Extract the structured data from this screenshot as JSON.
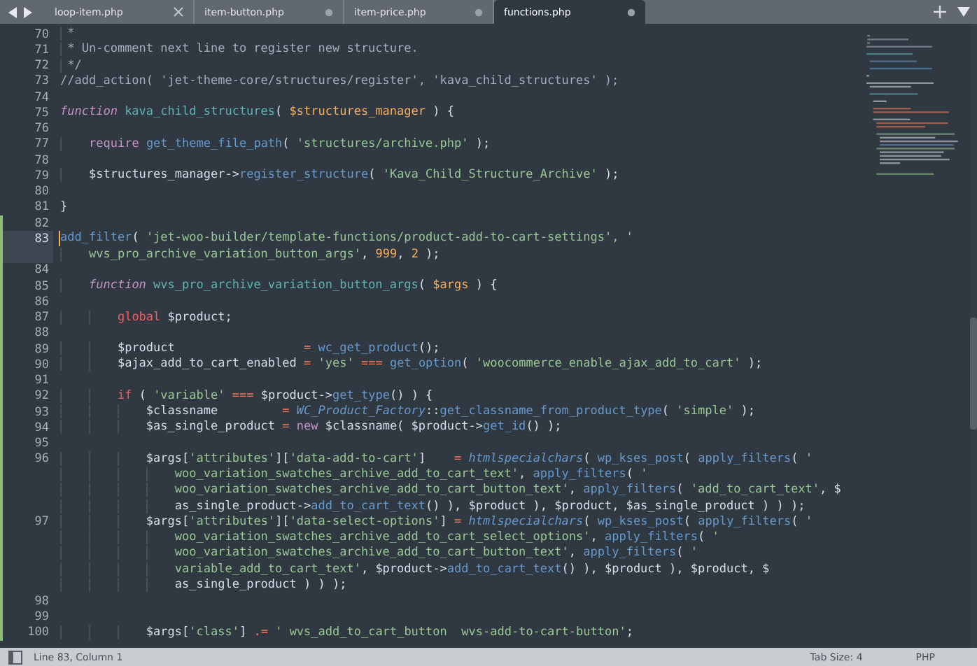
{
  "tabs": [
    {
      "label": "loop-item.php",
      "selected": false,
      "modified": false
    },
    {
      "label": "item-button.php",
      "selected": false,
      "modified": true
    },
    {
      "label": "item-price.php",
      "selected": false,
      "modified": true
    },
    {
      "label": "functions.php",
      "selected": true,
      "modified": true
    }
  ],
  "rows": [
    {
      "num": "70",
      "changed": false,
      "current": false,
      "tokens": [
        {
          "t": " *",
          "kind": "comment"
        }
      ]
    },
    {
      "num": "71",
      "changed": false,
      "current": false,
      "tokens": [
        {
          "t": " * Un-comment next line to register new structure.",
          "kind": "comment"
        }
      ]
    },
    {
      "num": "72",
      "changed": false,
      "current": false,
      "tokens": [
        {
          "t": " */",
          "kind": "comment"
        }
      ]
    },
    {
      "num": "73",
      "changed": false,
      "current": false,
      "tokens": [
        {
          "t": "//add_action( 'jet-theme-core/structures/register', 'kava_child_structures' );",
          "kind": "comment"
        }
      ]
    },
    {
      "num": "74",
      "changed": false,
      "current": false
    },
    {
      "num": "75",
      "changed": false,
      "current": false,
      "tokens": [
        {
          "t": "function ",
          "kind": "keyword"
        },
        {
          "t": "kava_child_structures",
          "kind": "defname"
        },
        {
          "t": "( ",
          "kind": "plain"
        },
        {
          "t": "$structures_manager",
          "kind": "param"
        },
        {
          "t": " ) {",
          "kind": "plain"
        }
      ]
    },
    {
      "num": "76",
      "changed": false,
      "current": false
    },
    {
      "num": "77",
      "changed": false,
      "current": false,
      "tokens": [
        {
          "t": "    require ",
          "kind": "storage"
        },
        {
          "t": "get_theme_file_path",
          "kind": "call"
        },
        {
          "t": "( ",
          "kind": "plain"
        },
        {
          "t": "'structures/archive.php'",
          "kind": "string"
        },
        {
          "t": " );",
          "kind": "plain"
        }
      ]
    },
    {
      "num": "78",
      "changed": false,
      "current": false
    },
    {
      "num": "79",
      "changed": false,
      "current": false,
      "tokens": [
        {
          "t": "    $structures_manager->",
          "kind": "plain"
        },
        {
          "t": "register_structure",
          "kind": "call"
        },
        {
          "t": "( ",
          "kind": "plain"
        },
        {
          "t": "'Kava_Child_Structure_Archive'",
          "kind": "string"
        },
        {
          "t": " );",
          "kind": "plain"
        }
      ]
    },
    {
      "num": "80",
      "changed": false,
      "current": false
    },
    {
      "num": "81",
      "changed": false,
      "current": false,
      "tokens": [
        {
          "t": "}",
          "kind": "plain"
        }
      ]
    },
    {
      "num": "82",
      "changed": true,
      "current": false
    },
    {
      "num": "83",
      "changed": true,
      "current": true,
      "tokens": [
        {
          "t": "add_filter",
          "kind": "call"
        },
        {
          "t": "( ",
          "kind": "plain"
        },
        {
          "t": "'jet-woo-builder/template-functions/product-add-to-cart-settings', '",
          "kind": "string"
        }
      ]
    },
    {
      "changed": true,
      "current": true,
      "tokens": [
        {
          "t": "    wvs_pro_archive_variation_button_args'",
          "kind": "string"
        },
        {
          "t": ", ",
          "kind": "plain"
        },
        {
          "t": "999",
          "kind": "number"
        },
        {
          "t": ", ",
          "kind": "plain"
        },
        {
          "t": "2",
          "kind": "number"
        },
        {
          "t": " );",
          "kind": "plain"
        }
      ]
    },
    {
      "num": "84",
      "changed": true,
      "current": false
    },
    {
      "num": "85",
      "changed": true,
      "current": false,
      "tokens": [
        {
          "t": "    function ",
          "kind": "keyword"
        },
        {
          "t": "wvs_pro_archive_variation_button_args",
          "kind": "defname"
        },
        {
          "t": "( ",
          "kind": "plain"
        },
        {
          "t": "$args",
          "kind": "param"
        },
        {
          "t": " ) {",
          "kind": "plain"
        }
      ]
    },
    {
      "num": "86",
      "changed": true,
      "current": false
    },
    {
      "num": "87",
      "changed": true,
      "current": false,
      "tokens": [
        {
          "t": "        global",
          "kind": "control"
        },
        {
          "t": " $product;",
          "kind": "plain"
        }
      ]
    },
    {
      "num": "88",
      "changed": true,
      "current": false
    },
    {
      "num": "89",
      "changed": true,
      "current": false,
      "tokens": [
        {
          "t": "        $product                  ",
          "kind": "plain"
        },
        {
          "t": "= ",
          "kind": "operator"
        },
        {
          "t": "wc_get_product",
          "kind": "call"
        },
        {
          "t": "();",
          "kind": "plain"
        }
      ]
    },
    {
      "num": "90",
      "changed": true,
      "current": false,
      "tokens": [
        {
          "t": "        $ajax_add_to_cart_enabled ",
          "kind": "plain"
        },
        {
          "t": "= ",
          "kind": "operator"
        },
        {
          "t": "'yes' ",
          "kind": "string"
        },
        {
          "t": "=== ",
          "kind": "operator"
        },
        {
          "t": "get_option",
          "kind": "call"
        },
        {
          "t": "( ",
          "kind": "plain"
        },
        {
          "t": "'woocommerce_enable_ajax_add_to_cart'",
          "kind": "string"
        },
        {
          "t": " );",
          "kind": "plain"
        }
      ]
    },
    {
      "num": "91",
      "changed": true,
      "current": false
    },
    {
      "num": "92",
      "changed": true,
      "current": false,
      "tokens": [
        {
          "t": "        if",
          "kind": "control"
        },
        {
          "t": " ( ",
          "kind": "plain"
        },
        {
          "t": "'variable' ",
          "kind": "string"
        },
        {
          "t": "===",
          "kind": "operator"
        },
        {
          "t": " $product->",
          "kind": "plain"
        },
        {
          "t": "get_type",
          "kind": "call"
        },
        {
          "t": "() ) {",
          "kind": "plain"
        }
      ]
    },
    {
      "num": "93",
      "changed": true,
      "current": false,
      "tokens": [
        {
          "t": "            $classname         ",
          "kind": "plain"
        },
        {
          "t": "= ",
          "kind": "operator"
        },
        {
          "t": "WC_Product_Factory",
          "kind": "classname"
        },
        {
          "t": "::",
          "kind": "plain"
        },
        {
          "t": "get_classname_from_product_type",
          "kind": "call"
        },
        {
          "t": "( ",
          "kind": "plain"
        },
        {
          "t": "'simple'",
          "kind": "string"
        },
        {
          "t": " );",
          "kind": "plain"
        }
      ]
    },
    {
      "num": "94",
      "changed": true,
      "current": false,
      "tokens": [
        {
          "t": "            $as_single_product ",
          "kind": "plain"
        },
        {
          "t": "= ",
          "kind": "operator"
        },
        {
          "t": "new",
          "kind": "storage"
        },
        {
          "t": " $classname( $product->",
          "kind": "plain"
        },
        {
          "t": "get_id",
          "kind": "call"
        },
        {
          "t": "() );",
          "kind": "plain"
        }
      ]
    },
    {
      "num": "95",
      "changed": true,
      "current": false
    },
    {
      "num": "96",
      "changed": true,
      "current": false,
      "tokens": [
        {
          "t": "            $args[",
          "kind": "plain"
        },
        {
          "t": "'attributes'",
          "kind": "string"
        },
        {
          "t": "][",
          "kind": "plain"
        },
        {
          "t": "'data-add-to-cart'",
          "kind": "string"
        },
        {
          "t": "]    ",
          "kind": "plain"
        },
        {
          "t": "= ",
          "kind": "operator"
        },
        {
          "t": "htmlspecialchars",
          "kind": "classname"
        },
        {
          "t": "( ",
          "kind": "plain"
        },
        {
          "t": "wp_kses_post",
          "kind": "call"
        },
        {
          "t": "( ",
          "kind": "plain"
        },
        {
          "t": "apply_filters",
          "kind": "call"
        },
        {
          "t": "( ",
          "kind": "plain"
        },
        {
          "t": "'",
          "kind": "string"
        }
      ]
    },
    {
      "changed": true,
      "current": false,
      "tokens": [
        {
          "t": "                woo_variation_swatches_archive_add_to_cart_text'",
          "kind": "string"
        },
        {
          "t": ", ",
          "kind": "plain"
        },
        {
          "t": "apply_filters",
          "kind": "call"
        },
        {
          "t": "( ",
          "kind": "plain"
        },
        {
          "t": "'",
          "kind": "string"
        }
      ]
    },
    {
      "changed": true,
      "current": false,
      "tokens": [
        {
          "t": "                woo_variation_swatches_archive_add_to_cart_button_text'",
          "kind": "string"
        },
        {
          "t": ", ",
          "kind": "plain"
        },
        {
          "t": "apply_filters",
          "kind": "call"
        },
        {
          "t": "( ",
          "kind": "plain"
        },
        {
          "t": "'add_to_cart_text'",
          "kind": "string"
        },
        {
          "t": ", $",
          "kind": "plain"
        }
      ]
    },
    {
      "changed": true,
      "current": false,
      "tokens": [
        {
          "t": "                as_single_product->",
          "kind": "plain"
        },
        {
          "t": "add_to_cart_text",
          "kind": "call"
        },
        {
          "t": "() ), $product ), $product, $as_single_product ) ) );",
          "kind": "plain"
        }
      ]
    },
    {
      "num": "97",
      "changed": true,
      "current": false,
      "tokens": [
        {
          "t": "            $args[",
          "kind": "plain"
        },
        {
          "t": "'attributes'",
          "kind": "string"
        },
        {
          "t": "][",
          "kind": "plain"
        },
        {
          "t": "'data-select-options'",
          "kind": "string"
        },
        {
          "t": "] ",
          "kind": "plain"
        },
        {
          "t": "= ",
          "kind": "operator"
        },
        {
          "t": "htmlspecialchars",
          "kind": "classname"
        },
        {
          "t": "( ",
          "kind": "plain"
        },
        {
          "t": "wp_kses_post",
          "kind": "call"
        },
        {
          "t": "( ",
          "kind": "plain"
        },
        {
          "t": "apply_filters",
          "kind": "call"
        },
        {
          "t": "( ",
          "kind": "plain"
        },
        {
          "t": "'",
          "kind": "string"
        }
      ]
    },
    {
      "changed": true,
      "current": false,
      "tokens": [
        {
          "t": "                woo_variation_swatches_archive_add_to_cart_select_options'",
          "kind": "string"
        },
        {
          "t": ", ",
          "kind": "plain"
        },
        {
          "t": "apply_filters",
          "kind": "call"
        },
        {
          "t": "( ",
          "kind": "plain"
        },
        {
          "t": "'",
          "kind": "string"
        }
      ]
    },
    {
      "changed": true,
      "current": false,
      "tokens": [
        {
          "t": "                woo_variation_swatches_archive_add_to_cart_button_text'",
          "kind": "string"
        },
        {
          "t": ", ",
          "kind": "plain"
        },
        {
          "t": "apply_filters",
          "kind": "call"
        },
        {
          "t": "( ",
          "kind": "plain"
        },
        {
          "t": "'",
          "kind": "string"
        }
      ]
    },
    {
      "changed": true,
      "current": false,
      "tokens": [
        {
          "t": "                variable_add_to_cart_text'",
          "kind": "string"
        },
        {
          "t": ", $product->",
          "kind": "plain"
        },
        {
          "t": "add_to_cart_text",
          "kind": "call"
        },
        {
          "t": "() ), $product ), $product, $",
          "kind": "plain"
        }
      ]
    },
    {
      "changed": true,
      "current": false,
      "tokens": [
        {
          "t": "                as_single_product ) ) );",
          "kind": "plain"
        }
      ]
    },
    {
      "num": "98",
      "changed": true,
      "current": false
    },
    {
      "num": "99",
      "changed": true,
      "current": false
    },
    {
      "num": "100",
      "changed": true,
      "current": false,
      "tokens": [
        {
          "t": "            $args[",
          "kind": "plain"
        },
        {
          "t": "'class'",
          "kind": "string"
        },
        {
          "t": "] ",
          "kind": "plain"
        },
        {
          "t": ".= ",
          "kind": "operator"
        },
        {
          "t": "' wvs_add_to_cart_button  wvs-add-to-cart-button'",
          "kind": "string"
        },
        {
          "t": ";",
          "kind": "plain"
        }
      ]
    }
  ],
  "status_bar": {
    "position": "Line 83, Column 1",
    "tab_size": "Tab Size: 4",
    "syntax": "PHP"
  }
}
